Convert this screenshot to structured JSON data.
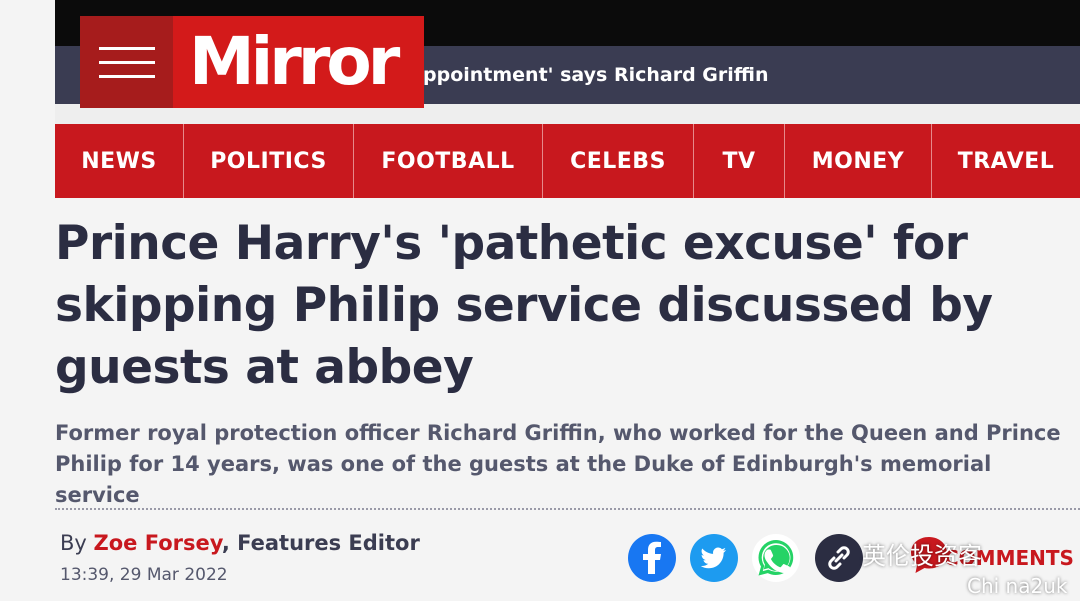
{
  "ticker": {
    "text": "ppointment' says Richard Griffin"
  },
  "logo": {
    "text": "Mirror",
    "color": "#d31a1a"
  },
  "menu": {
    "icon": "hamburger-menu-icon"
  },
  "nav": {
    "items": [
      "NEWS",
      "POLITICS",
      "FOOTBALL",
      "CELEBS",
      "TV",
      "MONEY",
      "TRAVEL"
    ],
    "background": "#c8181e"
  },
  "article": {
    "headline": "Prince Harry's 'pathetic excuse' for skipping Philip service discussed by guests at abbey",
    "standfirst": "Former royal protection officer Richard Griffin, who worked for the Queen and Prince Philip for 14 years, was one of the guests at the Duke of Edinburgh's memorial service",
    "byline_prefix": "By",
    "author": "Zoe Forsey",
    "author_role": ", Features Editor",
    "timestamp": "13:39, 29 Mar 2022"
  },
  "share": {
    "icons": [
      "facebook-icon",
      "twitter-icon",
      "whatsapp-icon",
      "link-icon"
    ],
    "comments_label": "COMMENTS"
  },
  "watermark": {
    "text": "英伦投资客",
    "sub": "Chi na2uk"
  }
}
